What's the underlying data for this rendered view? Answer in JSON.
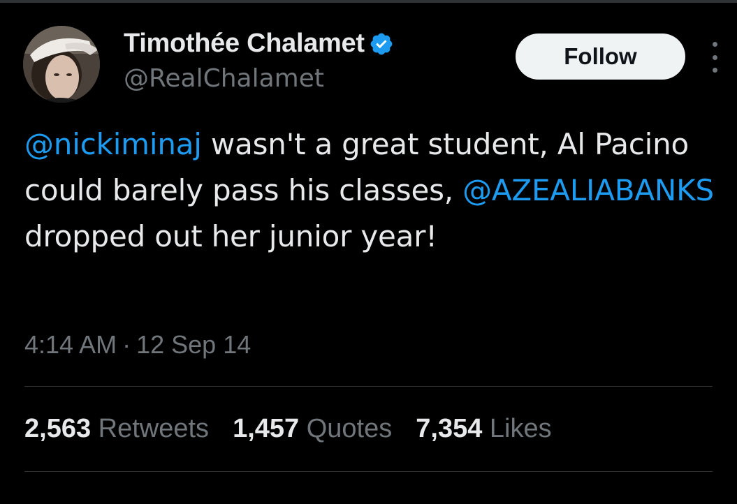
{
  "author": {
    "display_name": "Timothée Chalamet",
    "handle": "@RealChalamet",
    "verified": true
  },
  "follow_button": {
    "label": "Follow"
  },
  "more_menu": {
    "icon": "more-vertical-icon"
  },
  "tweet": {
    "segments": [
      {
        "text": "@nickiminaj",
        "type": "mention"
      },
      {
        "text": " wasn't a great student, Al Pacino could barely pass his classes, ",
        "type": "text"
      },
      {
        "text": "@AZEALIABANKS",
        "type": "mention"
      },
      {
        "text": " dropped out her junior year!",
        "type": "text"
      }
    ],
    "time": "4:14 AM",
    "separator": "·",
    "date": "12 Sep 14"
  },
  "stats": {
    "retweets": {
      "count": "2,563",
      "label": "Retweets"
    },
    "quotes": {
      "count": "1,457",
      "label": "Quotes"
    },
    "likes": {
      "count": "7,354",
      "label": "Likes"
    }
  },
  "colors": {
    "background": "#000000",
    "mention": "#1d9bf0",
    "verified": "#1d9bf0",
    "muted": "#71767b",
    "text": "#e7e9ea"
  }
}
